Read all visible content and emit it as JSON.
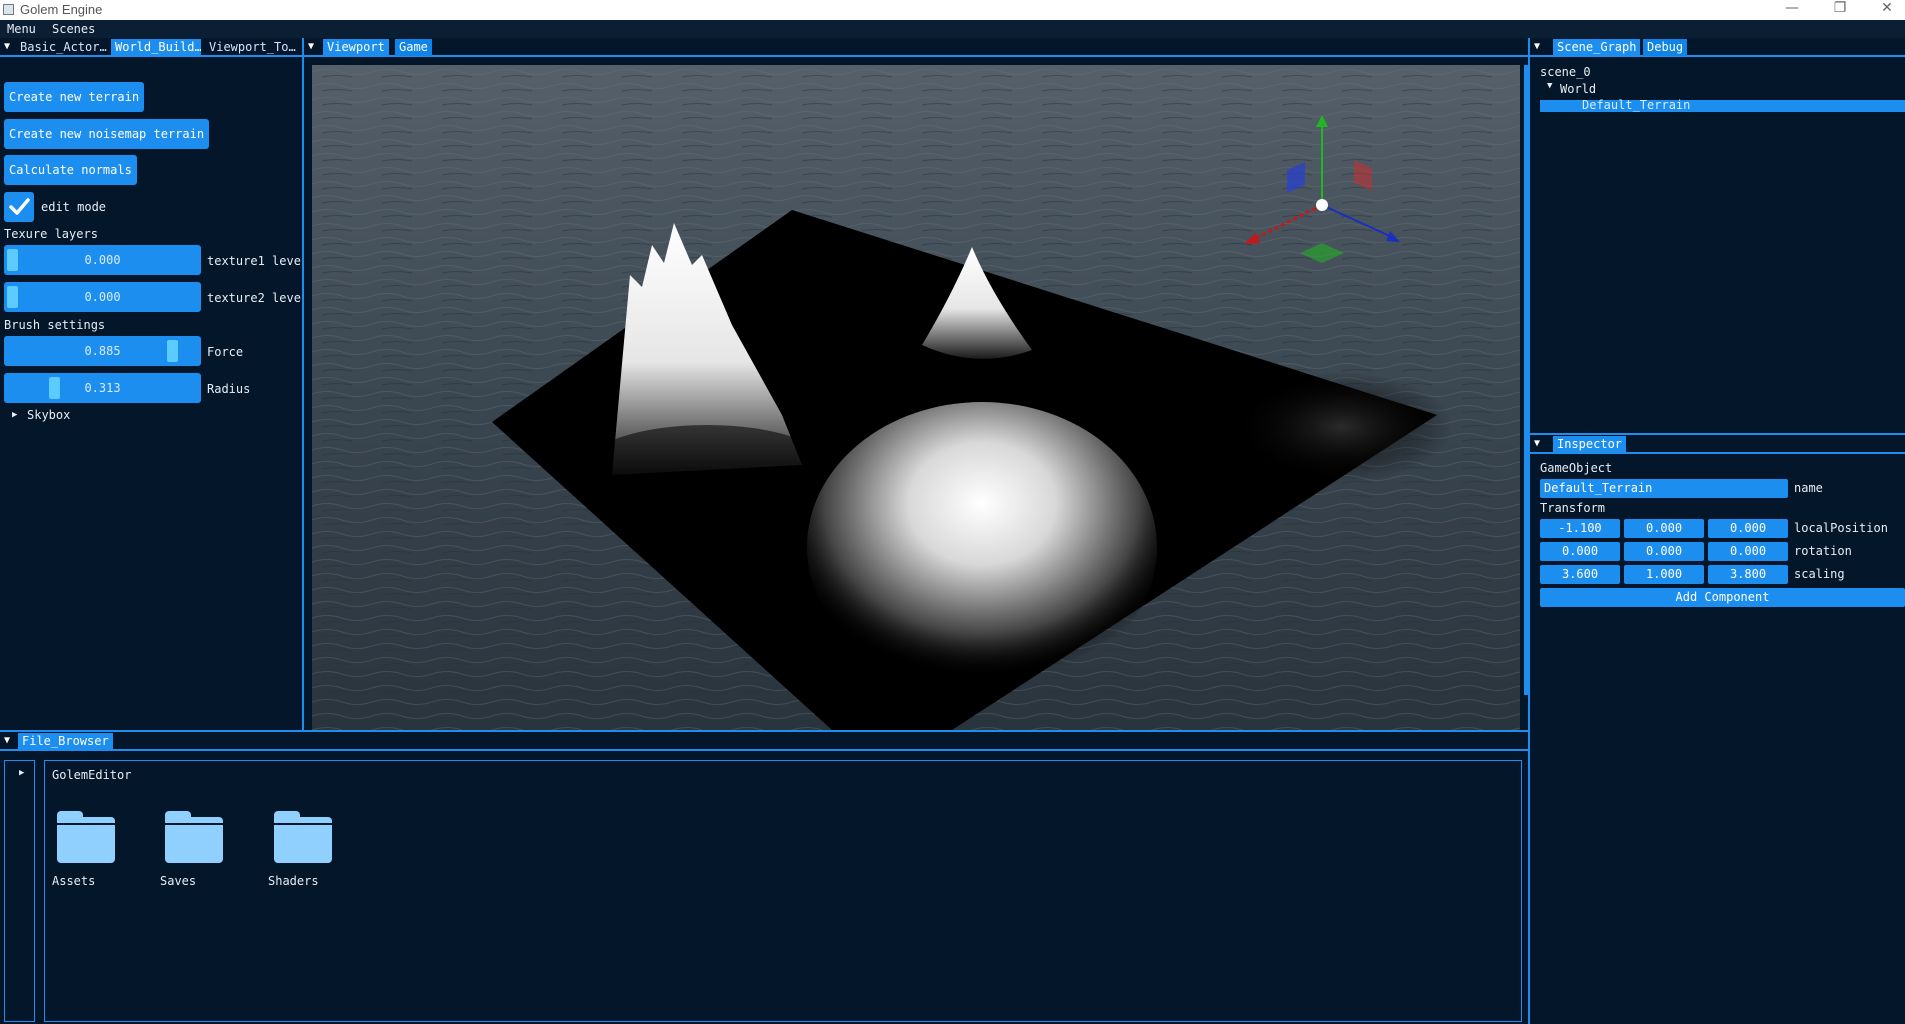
{
  "window": {
    "title": "Golem Engine",
    "controls": [
      "—",
      "❐",
      "✕"
    ]
  },
  "menubar": {
    "items": [
      "Menu",
      "Scenes"
    ]
  },
  "left_panel": {
    "tabs": [
      "Basic_Actor…",
      "World_Build…",
      "Viewport_To…"
    ],
    "active_tab": 1,
    "buttons": {
      "create_terrain": "Create new terrain",
      "create_noisemap": "Create new noisemap terrain",
      "calc_normals": "Calculate normals"
    },
    "edit_mode": {
      "label": "edit mode",
      "checked": true
    },
    "texture_layers": {
      "header": "Texure layers",
      "sliders": [
        {
          "value_text": "0.000",
          "value": 0.0,
          "label": "texture1 leve"
        },
        {
          "value_text": "0.000",
          "value": 0.0,
          "label": "texture2 leve"
        }
      ]
    },
    "brush_settings": {
      "header": "Brush settings",
      "sliders": [
        {
          "value_text": "0.885",
          "value": 0.885,
          "label": "Force"
        },
        {
          "value_text": "0.313",
          "value": 0.313,
          "label": "Radius"
        }
      ]
    },
    "skybox": {
      "arrow": "▶",
      "label": "Skybox"
    }
  },
  "center_panel": {
    "tabs": [
      "Viewport",
      "Game"
    ],
    "active_tab": 0
  },
  "scene_graph": {
    "tabs": [
      "Scene_Graph",
      "Debug"
    ],
    "active_tab": 0,
    "root": "scene_0",
    "world_arrow": "▼",
    "world": "World",
    "selected": "Default_Terrain"
  },
  "inspector": {
    "tab": "Inspector",
    "gameobject_label": "GameObject",
    "name_value": "Default_Terrain",
    "name_label": "name",
    "transform_label": "Transform",
    "rows": [
      {
        "label": "localPosition",
        "values": [
          "-1.100",
          "0.000",
          "0.000"
        ]
      },
      {
        "label": "rotation",
        "values": [
          "0.000",
          "0.000",
          "0.000"
        ]
      },
      {
        "label": "scaling",
        "values": [
          "3.600",
          "1.000",
          "3.800"
        ]
      }
    ],
    "add_component": "Add Component"
  },
  "file_browser": {
    "tab": "File_Browser",
    "tree_arrow": "▶",
    "path": "GolemEditor",
    "folders": [
      "Assets",
      "Saves",
      "Shaders"
    ]
  },
  "colors": {
    "background": "#03162a",
    "accent": "#1c8ef0",
    "slider_grab": "#5ccbff",
    "folder": "#8fd0ff"
  }
}
